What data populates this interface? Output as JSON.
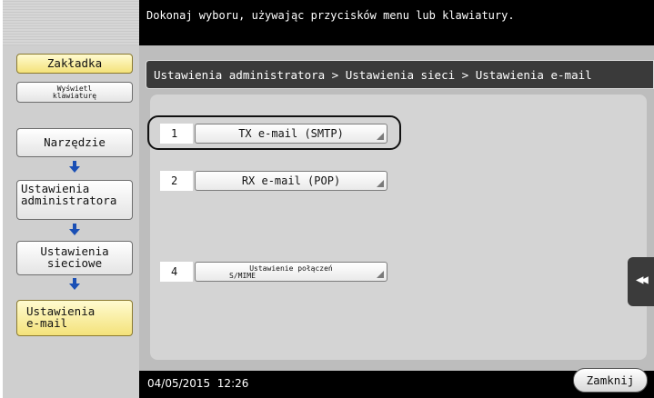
{
  "header": {
    "instruction": "Dokonaj wyboru, używając przycisków menu lub klawiatury."
  },
  "sidebar": {
    "bookmark_label": "Zakładka",
    "keyboard_label_line1": "Wyświetl",
    "keyboard_label_line2": "klawiaturę",
    "path": [
      {
        "line1": "Narzędzie",
        "line2": ""
      },
      {
        "line1": "Ustawienia",
        "line2": "administratora"
      },
      {
        "line1": "Ustawienia",
        "line2": "sieciowe"
      },
      {
        "line1": "Ustawienia",
        "line2": "e-mail"
      }
    ]
  },
  "breadcrumb": "Ustawienia administratora > Ustawienia sieci > Ustawienia e-mail",
  "menu": [
    {
      "num": "1",
      "label": "TX e-mail (SMTP)"
    },
    {
      "num": "2",
      "label": "RX e-mail (POP)"
    },
    {
      "num": "4",
      "label_line1": "Ustawienie połączeń",
      "label_line2": "S/MIME"
    }
  ],
  "side_tab_glyph": "◀◀",
  "footer": {
    "datetime": "04/05/2015  12:26",
    "close_label": "Zamknij"
  },
  "colors": {
    "highlight_yellow": "#f4e27a",
    "panel_gray": "#bdbdbd",
    "band_black": "#000000"
  }
}
